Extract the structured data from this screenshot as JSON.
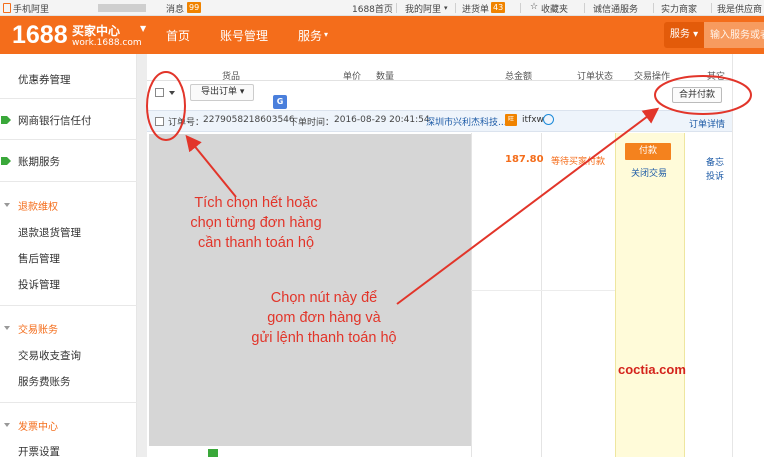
{
  "topbar": {
    "mobile": "手机阿里",
    "messages": "消息",
    "messages_count": "99",
    "home_1688": "1688首页",
    "my_ali": "我的阿里",
    "purchase_list": "进货单",
    "purchase_count": "43",
    "favorites": "收藏夹",
    "trust_service": "诚信通服务",
    "merchants": "实力商家",
    "supplier": "我是供应商"
  },
  "header": {
    "logo": "1688",
    "center_title": "买家中心",
    "site": "work.1688.com",
    "nav": [
      "首页",
      "账号管理",
      "服务"
    ],
    "service_button": "服务",
    "search_placeholder": "输入服务或者"
  },
  "sidebar": {
    "items": [
      {
        "label": "优惠券管理"
      },
      {
        "label": "网商银行信任付"
      },
      {
        "label": "账期服务"
      }
    ],
    "refund_section": "退款维权",
    "refund_items": [
      "退款退货管理",
      "售后管理",
      "投诉管理"
    ],
    "trade_section": "交易账务",
    "trade_items": [
      "交易收支查询",
      "服务费账务"
    ],
    "invoice_section": "发票中心",
    "invoice_items": [
      "开票设置"
    ]
  },
  "table": {
    "headers": [
      "货品",
      "单价",
      "数量",
      "总金额",
      "订单状态",
      "交易操作",
      "其它"
    ],
    "export_button": "导出订单",
    "merge_pay_button": "合并付款"
  },
  "order": {
    "number_label": "订单号：",
    "number": "2279058218603546",
    "time_label": "下单时间：",
    "time": "2016-08-29 20:41:54",
    "seller": "深圳市兴利杰科技...",
    "wangwang": "itfxw",
    "detail_link": "订单详情",
    "amount": "187.80",
    "status": "等待买家付款",
    "pay_button": "付款",
    "close_link": "关闭交易",
    "note_link": "备忘",
    "complain_link": "投诉"
  },
  "annotations": {
    "checkbox_note": [
      "Tích chọn hết hoặc",
      "chọn từng đơn hàng",
      "cần thanh toán hộ"
    ],
    "button_note": [
      "Chọn nút này để",
      "gom đơn hàng và",
      "gửi lệnh thanh toán hộ"
    ],
    "watermark": "coctia.com"
  },
  "colors": {
    "brand_orange": "#f46d1b",
    "annotation_red": "#e2352a"
  }
}
